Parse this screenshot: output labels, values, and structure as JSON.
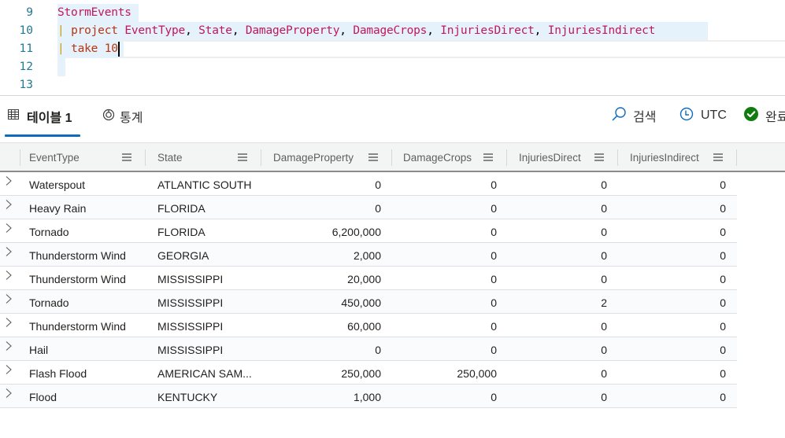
{
  "editor": {
    "lines": [
      {
        "number": "9"
      },
      {
        "number": "10"
      },
      {
        "number": "11"
      },
      {
        "number": "12"
      },
      {
        "number": "13"
      }
    ],
    "table_name": "StormEvents",
    "pipe": "|",
    "project_keyword": "project",
    "project_columns": [
      "EventType",
      "State",
      "DamageProperty",
      "DamageCrops",
      "InjuriesDirect",
      "InjuriesIndirect"
    ],
    "comma": ",",
    "take_keyword": "take",
    "take_value": "10"
  },
  "tabs": [
    {
      "label": "테이블 1",
      "icon": "table-icon",
      "active": true
    },
    {
      "label": "통계",
      "icon": "stats-icon",
      "active": false
    }
  ],
  "toolbar": {
    "search_label": "검색",
    "timezone_label": "UTC",
    "status_label": "완료",
    "accent_color": "#0f6cbd",
    "status_color": "#107c10"
  },
  "grid": {
    "columns": [
      "EventType",
      "State",
      "DamageProperty",
      "DamageCrops",
      "InjuriesDirect",
      "InjuriesIndirect"
    ],
    "rows": [
      [
        "Waterspout",
        "ATLANTIC SOUTH",
        "0",
        "0",
        "0",
        "0"
      ],
      [
        "Heavy Rain",
        "FLORIDA",
        "0",
        "0",
        "0",
        "0"
      ],
      [
        "Tornado",
        "FLORIDA",
        "6,200,000",
        "0",
        "0",
        "0"
      ],
      [
        "Thunderstorm Wind",
        "GEORGIA",
        "2,000",
        "0",
        "0",
        "0"
      ],
      [
        "Thunderstorm Wind",
        "MISSISSIPPI",
        "20,000",
        "0",
        "0",
        "0"
      ],
      [
        "Tornado",
        "MISSISSIPPI",
        "450,000",
        "0",
        "2",
        "0"
      ],
      [
        "Thunderstorm Wind",
        "MISSISSIPPI",
        "60,000",
        "0",
        "0",
        "0"
      ],
      [
        "Hail",
        "MISSISSIPPI",
        "0",
        "0",
        "0",
        "0"
      ],
      [
        "Flash Flood",
        "AMERICAN SAM...",
        "250,000",
        "250,000",
        "0",
        "0"
      ],
      [
        "Flood",
        "KENTUCKY",
        "1,000",
        "0",
        "0",
        "0"
      ]
    ]
  }
}
